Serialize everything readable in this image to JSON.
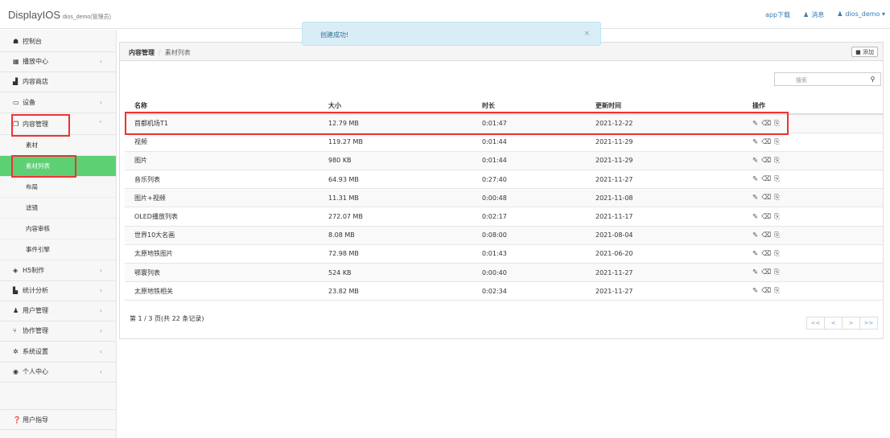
{
  "brand": {
    "title": "DisplayIOS",
    "user_role": "dios_demo(管理员)"
  },
  "topnav": {
    "app_download": "app下载",
    "messages": "消息",
    "user": "dios_demo"
  },
  "toast": {
    "message": "创建成功!",
    "close": "×"
  },
  "sidebar": {
    "items": [
      {
        "label": "控制台",
        "icon": "dashboard-icon",
        "glyph": "☗"
      },
      {
        "label": "播放中心",
        "icon": "grid-icon",
        "glyph": "▦",
        "arrow": "‹"
      },
      {
        "label": "内容商店",
        "icon": "store-icon",
        "glyph": "▟"
      },
      {
        "label": "设备",
        "icon": "monitor-icon",
        "glyph": "▭",
        "arrow": "‹"
      },
      {
        "label": "内容管理",
        "icon": "copy-icon",
        "glyph": "❐",
        "arrow": "˅"
      },
      {
        "label": "H5制作",
        "icon": "bookmark-icon",
        "glyph": "◈",
        "arrow": "‹"
      },
      {
        "label": "统计分析",
        "icon": "bar-chart-icon",
        "glyph": "▙",
        "arrow": "‹"
      },
      {
        "label": "用户管理",
        "icon": "users-icon",
        "glyph": "♟",
        "arrow": "‹"
      },
      {
        "label": "协作管理",
        "icon": "branch-icon",
        "glyph": "⑂",
        "arrow": "‹"
      },
      {
        "label": "系统设置",
        "icon": "gear-icon",
        "glyph": "✲",
        "arrow": "‹"
      },
      {
        "label": "个人中心",
        "icon": "user-circle-icon",
        "glyph": "◉",
        "arrow": "‹"
      },
      {
        "label": "用户指导",
        "icon": "help-icon",
        "glyph": "❓"
      }
    ],
    "sub_items": [
      "素材",
      "素材列表",
      "布局",
      "滤镜",
      "内容审核",
      "事件引擎"
    ]
  },
  "breadcrumb": {
    "root": "内容管理",
    "separator": "/",
    "current": "素材列表"
  },
  "add_button": {
    "icon": "plus-square-icon",
    "label": "添加"
  },
  "search": {
    "placeholder": "搜索"
  },
  "table": {
    "headers": [
      "名称",
      "大小",
      "时长",
      "更新时间",
      "操作"
    ],
    "rows": [
      {
        "name": "首都机场T1",
        "size": "12.79 MB",
        "duration": "0:01:47",
        "updated": "2021-12-22"
      },
      {
        "name": "视频",
        "size": "119.27 MB",
        "duration": "0:01:44",
        "updated": "2021-11-29"
      },
      {
        "name": "图片",
        "size": "980 KB",
        "duration": "0:01:44",
        "updated": "2021-11-29"
      },
      {
        "name": "音乐列表",
        "size": "64.93 MB",
        "duration": "0:27:40",
        "updated": "2021-11-27"
      },
      {
        "name": "图片+视频",
        "size": "11.31 MB",
        "duration": "0:00:48",
        "updated": "2021-11-08"
      },
      {
        "name": "OLED播放列表",
        "size": "272.07 MB",
        "duration": "0:02:17",
        "updated": "2021-11-17"
      },
      {
        "name": "世界10大名画",
        "size": "8.08 MB",
        "duration": "0:08:00",
        "updated": "2021-08-04"
      },
      {
        "name": "太原地铁图片",
        "size": "72.98 MB",
        "duration": "0:01:43",
        "updated": "2021-06-20"
      },
      {
        "name": "鄂寰列表",
        "size": "524 KB",
        "duration": "0:00:40",
        "updated": "2021-11-27"
      },
      {
        "name": "太原地铁相关",
        "size": "23.82 MB",
        "duration": "0:02:34",
        "updated": "2021-11-27"
      }
    ],
    "row_actions": [
      "edit-icon",
      "delete-icon",
      "copy-icon"
    ]
  },
  "pager": {
    "info": "第 1 / 3 页(共 22 条记录)",
    "buttons": [
      "<<",
      "<",
      ">",
      ">>"
    ]
  },
  "highlight_color": "#e33333",
  "active_color": "#5dd074"
}
